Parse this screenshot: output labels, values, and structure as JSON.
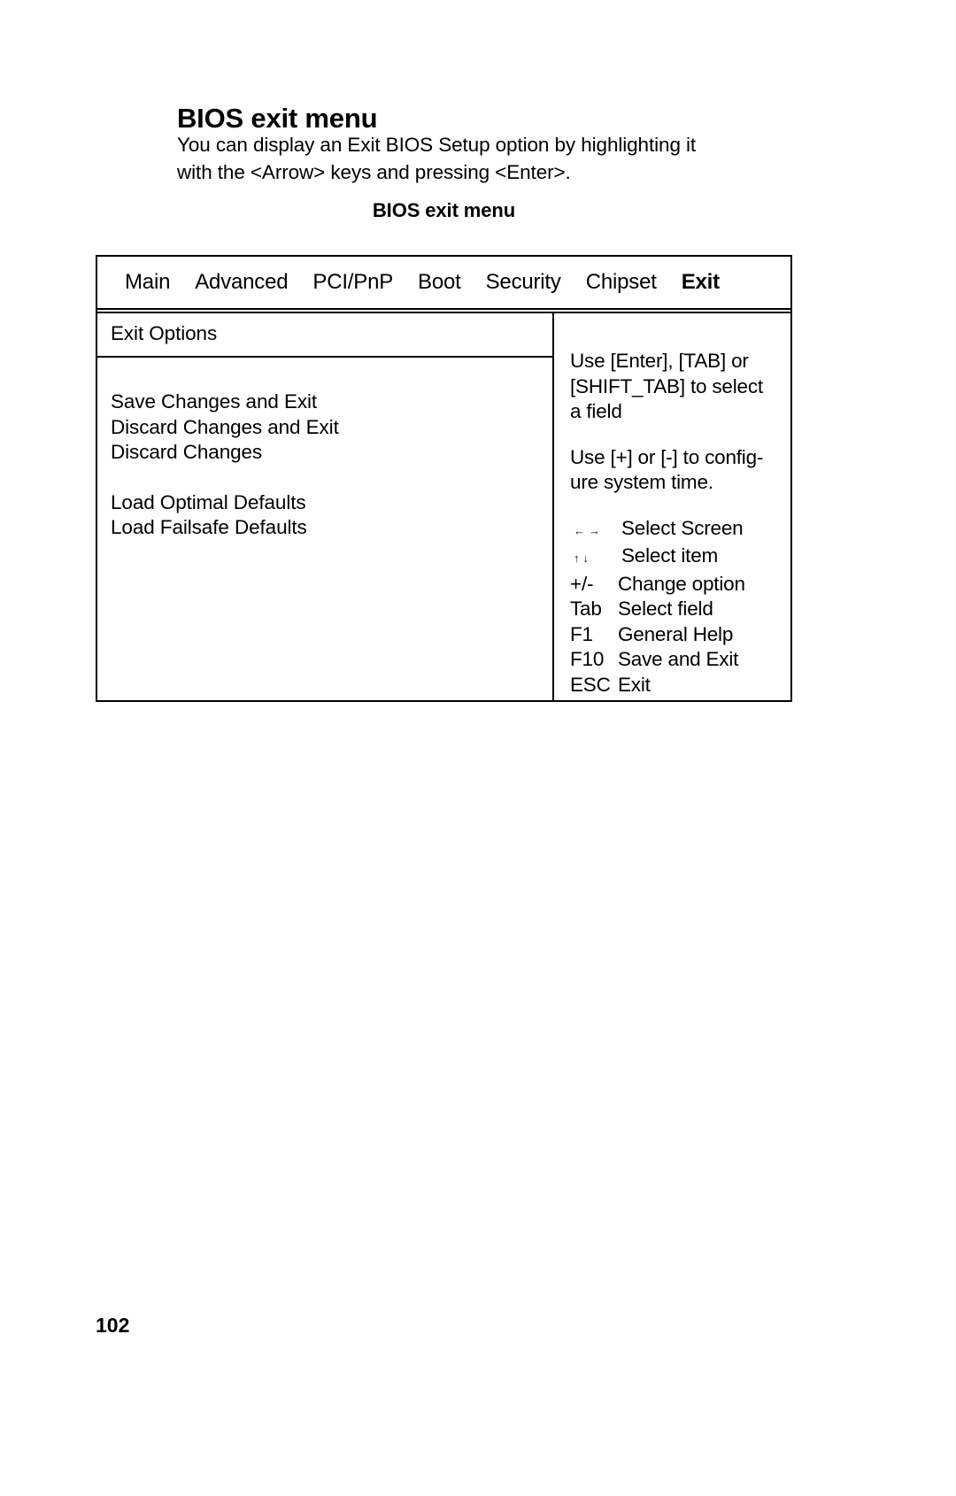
{
  "document": {
    "section_heading": "BIOS exit menu",
    "intro_lines": [
      "You can display an Exit BIOS Setup option by highlighting it",
      "with the <Arrow> keys and pressing <Enter>."
    ],
    "table_caption": "BIOS exit menu",
    "page_number": "102"
  },
  "bios_screen": {
    "tabs": [
      {
        "label": "Main",
        "active": false
      },
      {
        "label": "Advanced",
        "active": false
      },
      {
        "label": "PCI/PnP",
        "active": false
      },
      {
        "label": "Boot",
        "active": false
      },
      {
        "label": "Security",
        "active": false
      },
      {
        "label": "Chipset",
        "active": false
      },
      {
        "label": "Exit",
        "active": true
      }
    ],
    "left_pane": {
      "header": "Exit Options",
      "group_one": [
        "Save Changes and Exit",
        "Discard Changes and Exit",
        "Discard Changes"
      ],
      "group_two": [
        "Load Optimal Defaults",
        "Load Failsafe Defaults"
      ]
    },
    "right_pane": {
      "help_paragraph_1": [
        "Use [Enter], [TAB] or",
        "[SHIFT_TAB] to select",
        "a field"
      ],
      "help_paragraph_2": [
        "Use [+] or [-] to config-",
        "ure system time."
      ],
      "key_legend": [
        {
          "key": "←→",
          "desc": "Select Screen"
        },
        {
          "key": "↑↓",
          "desc": "Select item"
        },
        {
          "key": "+/-",
          "desc": "Change option"
        },
        {
          "key": "Tab",
          "desc": "Select field"
        },
        {
          "key": "F1",
          "desc": "General Help"
        },
        {
          "key": "F10",
          "desc": "Save and Exit"
        },
        {
          "key": "ESC",
          "desc": "Exit"
        }
      ]
    }
  },
  "colors": {
    "ink": "#000000",
    "paper": "#ffffff"
  }
}
